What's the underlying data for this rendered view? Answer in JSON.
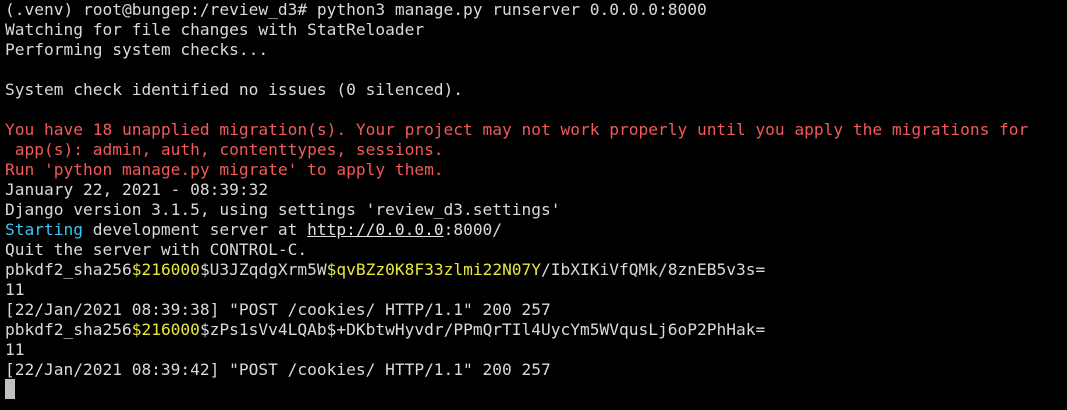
{
  "terminal": {
    "colors": {
      "background": "#000000",
      "default": "#d9d9d9",
      "red": "#f05a5a",
      "cyan": "#3cc6f0",
      "yellow": "#e8e83a",
      "cursor": "#c0c0c0"
    },
    "lines": [
      {
        "kind": "prompt",
        "segments": [
          {
            "text": "(.venv) root@bungep:/review_d3# python3 manage.py runserver 0.0.0.0:8000",
            "color": "default"
          }
        ]
      },
      {
        "kind": "output",
        "segments": [
          {
            "text": "Watching for file changes with StatReloader",
            "color": "default"
          }
        ]
      },
      {
        "kind": "output",
        "segments": [
          {
            "text": "Performing system checks...",
            "color": "default"
          }
        ]
      },
      {
        "kind": "blank",
        "segments": [
          {
            "text": "",
            "color": "default"
          }
        ]
      },
      {
        "kind": "output",
        "segments": [
          {
            "text": "System check identified no issues (0 silenced).",
            "color": "default"
          }
        ]
      },
      {
        "kind": "blank",
        "segments": [
          {
            "text": "",
            "color": "default"
          }
        ]
      },
      {
        "kind": "warning",
        "segments": [
          {
            "text": "You have 18 unapplied migration(s). Your project may not work properly until you apply the migrations for",
            "color": "red"
          }
        ]
      },
      {
        "kind": "warning",
        "segments": [
          {
            "text": " app(s): admin, auth, contenttypes, sessions.",
            "color": "red"
          }
        ]
      },
      {
        "kind": "warning",
        "segments": [
          {
            "text": "Run 'python manage.py migrate' to apply them.",
            "color": "red"
          }
        ]
      },
      {
        "kind": "output",
        "segments": [
          {
            "text": "January 22, 2021 - 08:39:32",
            "color": "default"
          }
        ]
      },
      {
        "kind": "output",
        "segments": [
          {
            "text": "Django version 3.1.5, using settings 'review_d3.settings'",
            "color": "default"
          }
        ]
      },
      {
        "kind": "output",
        "segments": [
          {
            "text": "Starting",
            "color": "cyan"
          },
          {
            "text": " development server at ",
            "color": "default"
          },
          {
            "text": "http://0.0.0.0",
            "color": "link"
          },
          {
            "text": ":8000/",
            "color": "default"
          }
        ]
      },
      {
        "kind": "output",
        "segments": [
          {
            "text": "Quit the server with CONTROL-C.",
            "color": "default"
          }
        ]
      },
      {
        "kind": "output",
        "segments": [
          {
            "text": "pbkdf2_sha256",
            "color": "default"
          },
          {
            "text": "$216000",
            "color": "yellow"
          },
          {
            "text": "$U3JZqdgXrm5W",
            "color": "default"
          },
          {
            "text": "$qvBZz0K8F33zlmi22N07Y",
            "color": "yellow"
          },
          {
            "text": "/IbXIKiVfQMk/8znEB5v3s=",
            "color": "default"
          }
        ]
      },
      {
        "kind": "output",
        "segments": [
          {
            "text": "11",
            "color": "default"
          }
        ]
      },
      {
        "kind": "log",
        "segments": [
          {
            "text": "[22/Jan/2021 08:39:38] \"POST /cookies/ HTTP/1.1\" 200 257",
            "color": "default"
          }
        ]
      },
      {
        "kind": "output",
        "segments": [
          {
            "text": "pbkdf2_sha256",
            "color": "default"
          },
          {
            "text": "$216000",
            "color": "yellow"
          },
          {
            "text": "$zPs1sVv4LQAb$+DKbtwHyvdr/PPmQrTIl4UycYm5WVqusLj6oP2PhHak=",
            "color": "default"
          }
        ]
      },
      {
        "kind": "output",
        "segments": [
          {
            "text": "11",
            "color": "default"
          }
        ]
      },
      {
        "kind": "log",
        "segments": [
          {
            "text": "[22/Jan/2021 08:39:42] \"POST /cookies/ HTTP/1.1\" 200 257",
            "color": "default"
          }
        ]
      }
    ]
  }
}
